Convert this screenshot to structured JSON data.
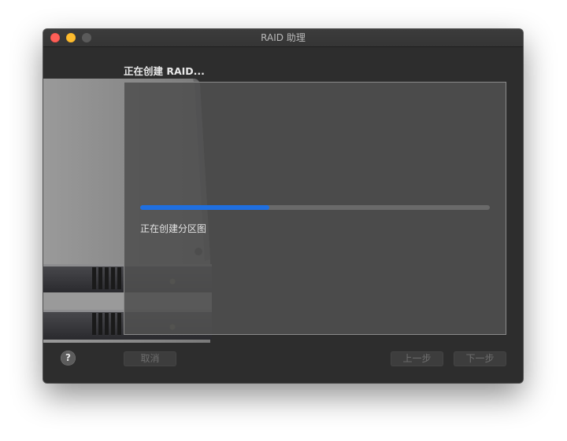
{
  "window": {
    "title": "RAID 助理"
  },
  "main": {
    "heading": "正在创建 RAID...",
    "progress": 0.37,
    "status": "正在创建分区图"
  },
  "footer": {
    "help_label": "?",
    "cancel_label": "取消",
    "back_label": "上一步",
    "next_label": "下一步"
  },
  "colors": {
    "progress_fill": "#1f6fe0",
    "close": "#fe5f57",
    "minimize": "#febc2e"
  },
  "icons": [
    "close-button",
    "minimize-button",
    "zoom-button",
    "mac-pro-illustration"
  ]
}
